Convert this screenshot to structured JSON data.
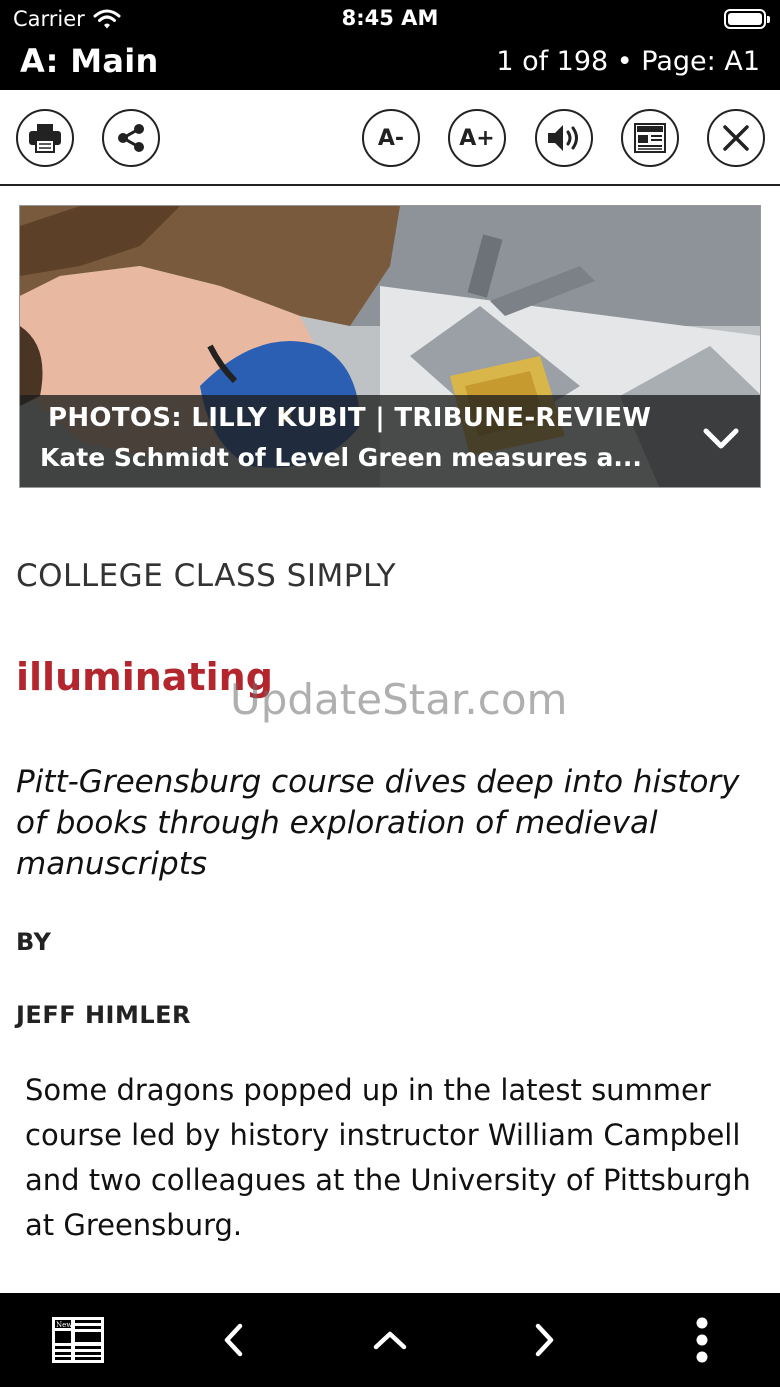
{
  "status": {
    "carrier": "Carrier",
    "time": "8:45 AM"
  },
  "header": {
    "section": "A: Main",
    "page_indicator": "1 of 198 • Page: A1"
  },
  "toolbar": {
    "print": "print-icon",
    "share": "share-icon",
    "font_decrease": "A-",
    "font_increase": "A+",
    "audio": "speaker-icon",
    "page_view": "newspaper-icon",
    "close": "close-icon"
  },
  "photo": {
    "credit": "PHOTOS: LILLY KUBIT | TRIBUNE-REVIEW",
    "caption": "Kate Schmidt of Level Green measures a..."
  },
  "article": {
    "kicker": "COLLEGE CLASS SIMPLY",
    "headline": "illuminating",
    "watermark": "UpdateStar.com",
    "deck": "Pitt-Greensburg course dives deep into history of books through exploration of medieval manuscripts",
    "byline_label": "BY",
    "author": "JEFF HIMLER",
    "body": "Some dragons popped up in the latest summer course led by history instructor William Campbell and two colleagues at the University of Pittsburgh at Greensburg."
  },
  "bottom_nav": [
    "newspaper-icon",
    "chevron-left-icon",
    "chevron-up-icon",
    "chevron-right-icon",
    "more-vertical-icon"
  ],
  "colors": {
    "headline": "#b3262d",
    "bars": "#000000"
  }
}
